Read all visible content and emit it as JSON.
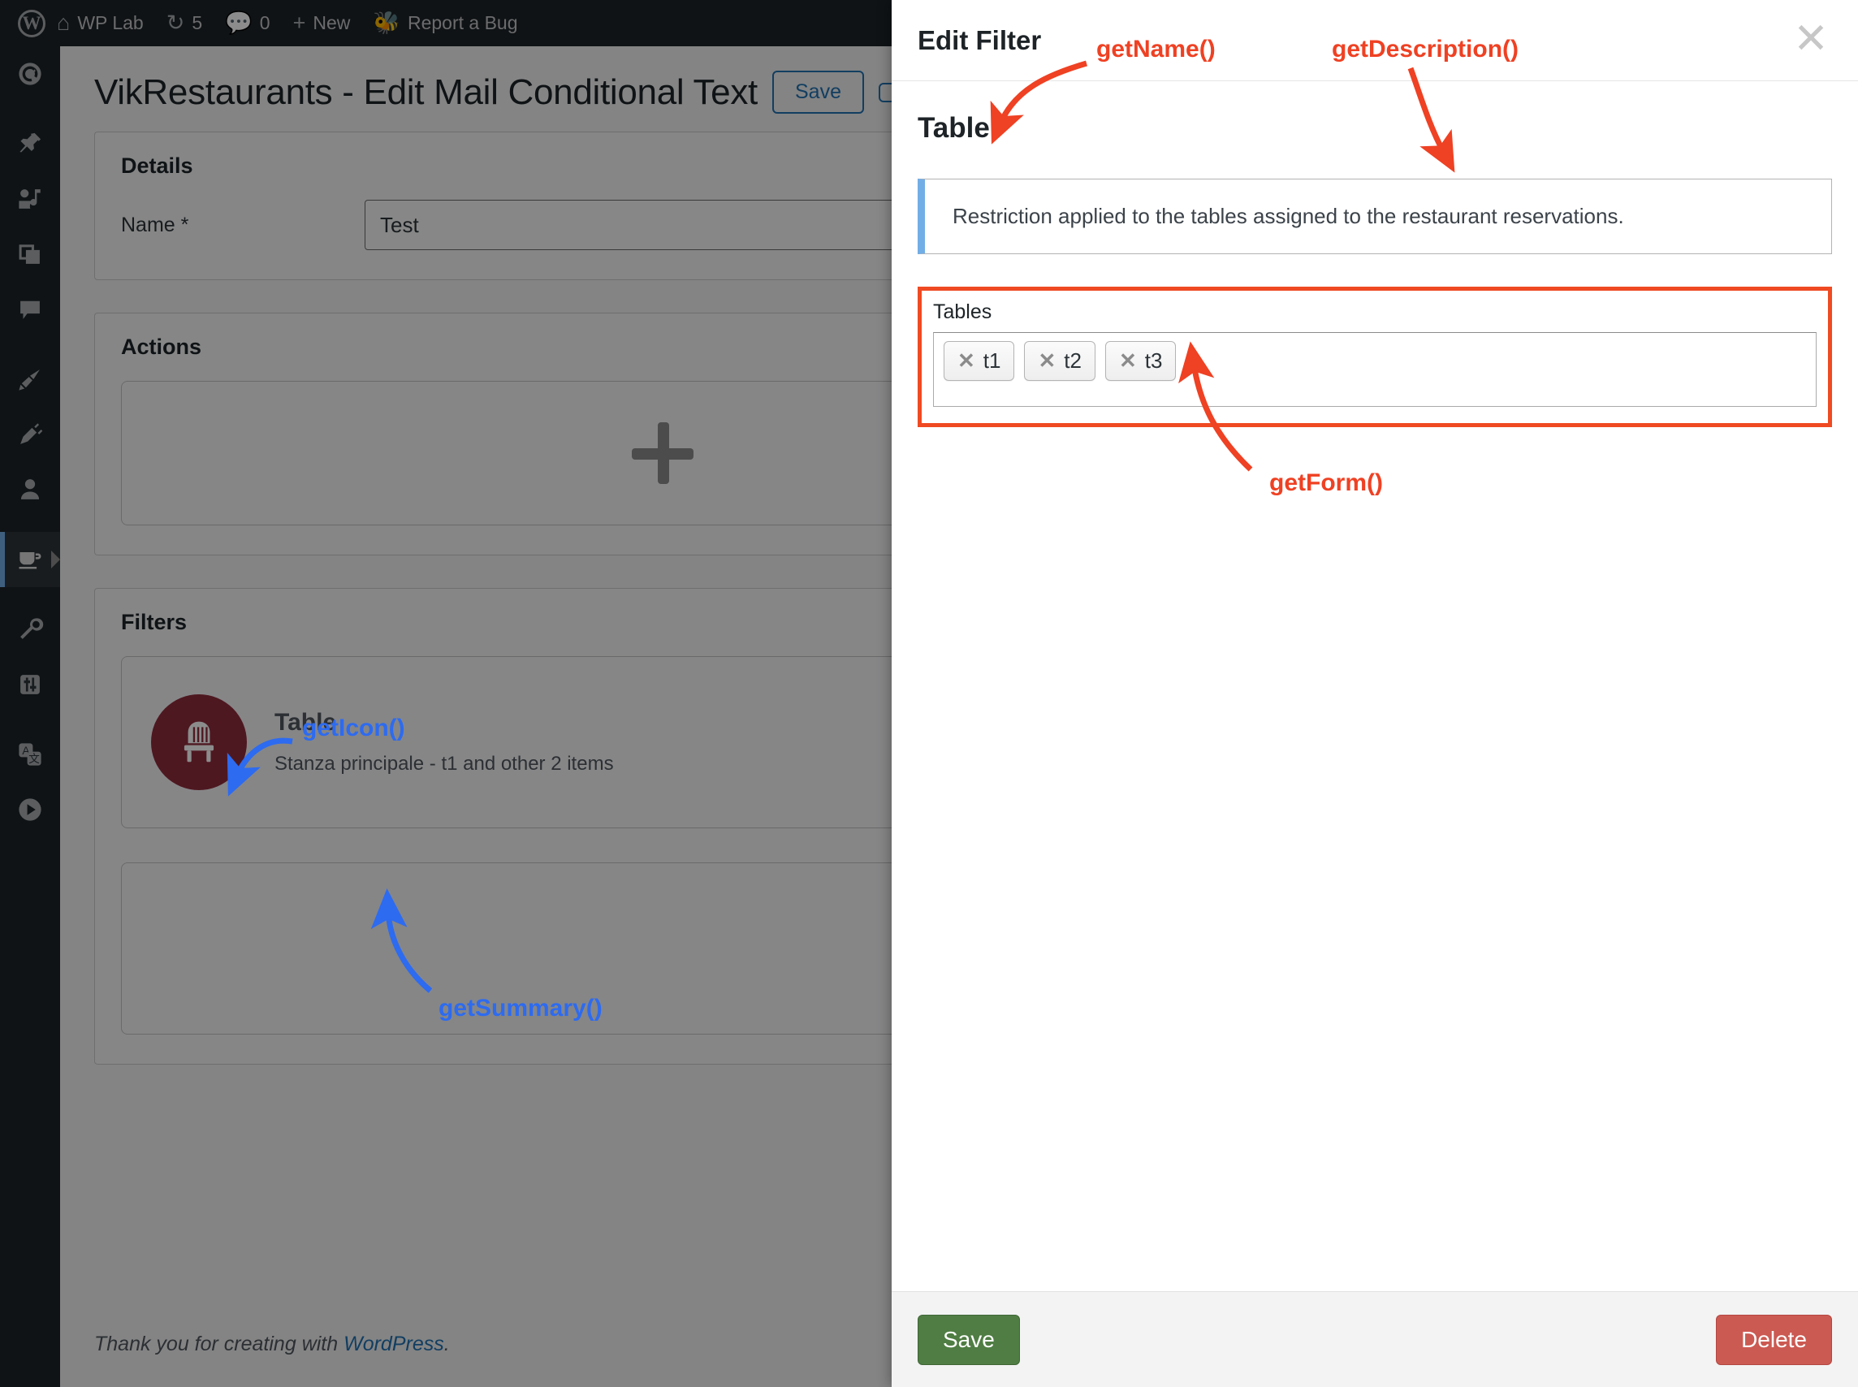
{
  "admin_bar": {
    "logo": "wordpress-logo",
    "items": [
      {
        "icon": "home-icon",
        "label": "WP Lab"
      },
      {
        "icon": "updates-icon",
        "label": "5"
      },
      {
        "icon": "comments-icon",
        "label": "0"
      },
      {
        "icon": "plus-icon",
        "label": "New"
      },
      {
        "icon": "bug-icon",
        "label": "Report a Bug"
      }
    ]
  },
  "admin_menu": {
    "items": [
      {
        "name": "dashboard",
        "icon": "dashboard-icon",
        "current": false
      },
      {
        "name": "posts",
        "icon": "pin-icon",
        "current": false
      },
      {
        "name": "media",
        "icon": "media-icon",
        "current": false
      },
      {
        "name": "pages",
        "icon": "pages-icon",
        "current": false
      },
      {
        "name": "comments",
        "icon": "comment-icon",
        "current": false
      },
      {
        "name": "appearance",
        "icon": "paintbrush-icon",
        "current": false
      },
      {
        "name": "plugins",
        "icon": "plug-icon",
        "current": false
      },
      {
        "name": "users",
        "icon": "user-icon",
        "current": false
      },
      {
        "name": "vikrestaurants",
        "icon": "coffee-cup-icon",
        "current": true
      },
      {
        "name": "tools",
        "icon": "wrench-icon",
        "current": false
      },
      {
        "name": "settings",
        "icon": "sliders-icon",
        "current": false
      },
      {
        "name": "translations",
        "icon": "translate-icon",
        "current": false
      },
      {
        "name": "collapse",
        "icon": "play-circle-icon",
        "current": false
      }
    ]
  },
  "page": {
    "title": "VikRestaurants - Edit Mail Conditional Text",
    "save_label": "Save",
    "second_button_label": ""
  },
  "details_panel": {
    "title": "Details",
    "name_label": "Name *",
    "name_value": "Test"
  },
  "actions_panel": {
    "title": "Actions",
    "add_icon": "plus-icon"
  },
  "filters_panel": {
    "title": "Filters",
    "cards": [
      {
        "icon": "chair-icon",
        "icon_background": "#8f2c3c",
        "title": "Table",
        "summary": "Stanza principale - t1 and other 2 items"
      }
    ]
  },
  "footer": {
    "text_before": "Thank you for creating with ",
    "link": "WordPress",
    "text_after": "."
  },
  "modal": {
    "title": "Edit Filter",
    "close_icon": "close-icon",
    "filter_name": "Table",
    "description": "Restriction applied to the tables assigned to the restaurant reservations.",
    "form": {
      "field_label": "Tables",
      "chips": [
        {
          "remove_icon": "x-icon",
          "label": "t1"
        },
        {
          "remove_icon": "x-icon",
          "label": "t2"
        },
        {
          "remove_icon": "x-icon",
          "label": "t3"
        }
      ]
    },
    "save_label": "Save",
    "delete_label": "Delete"
  },
  "annotations": {
    "red_color": "#ef4123",
    "blue_color": "#2d6bf0",
    "items": [
      {
        "id": "get-name",
        "label": "getName()",
        "color": "red"
      },
      {
        "id": "get-description",
        "label": "getDescription()",
        "color": "red"
      },
      {
        "id": "get-form",
        "label": "getForm()",
        "color": "red"
      },
      {
        "id": "get-icon",
        "label": "getIcon()",
        "color": "blue"
      },
      {
        "id": "get-summary",
        "label": "getSummary()",
        "color": "blue"
      }
    ]
  }
}
